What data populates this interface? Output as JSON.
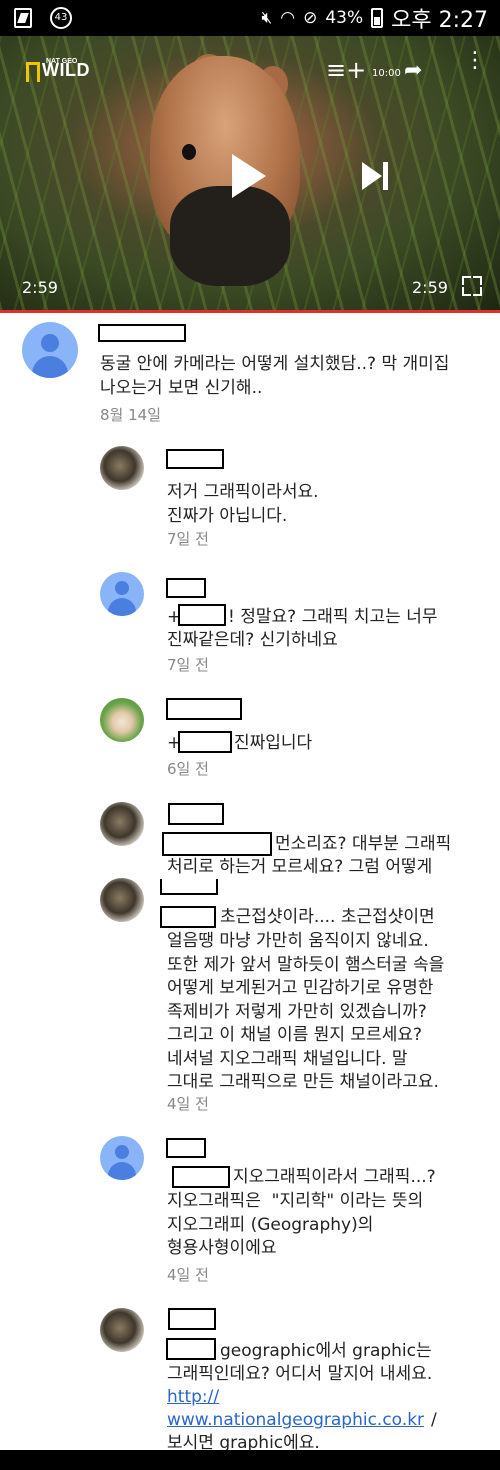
{
  "status_bar": {
    "notification_count": "43",
    "battery_percent": "43%",
    "time": "오후 2:27"
  },
  "video": {
    "channel_logo_small": "NAT GEO",
    "channel_logo_big": "WILD",
    "elapsed": "2:59",
    "duration": "2:59",
    "overlay_text": "10:00"
  },
  "comments": [
    {
      "body": "동굴 안에 카메라는 어떻게 설치했담..? 막 개미집\n나오는거 보면 신기해..",
      "time": "8월 14일"
    },
    {
      "body": "저거 그래픽이라서요.\n진짜가 아닙니다.",
      "time": "7일 전"
    },
    {
      "body_prefix": "+",
      "body_after": "! 정말요? 그래픽 치고는 너무",
      "body_line2": "진짜같은데? 신기하네요",
      "time": "7일 전"
    },
    {
      "body_prefix": "+",
      "body_after": "진짜입니다",
      "time": "6일 전"
    },
    {
      "body_after": "먼소리죠? 대부분 그래픽",
      "body_line2": "처리로 하는거 모르세요? 그럼 어떻게"
    },
    {
      "body_after": "초근접샷이라.... 초근접샷이면",
      "body_rest": "얼음땡 마냥 가만히 움직이지 않네요.\n또한 제가 앞서 말하듯이 햄스터굴 속을\n어떻게 보게된거고 민감하기로 유명한\n족제비가 저렇게 가만히 있겠습니까?\n그리고 이 채널 이름 뭔지 모르세요?\n네셔널 지오그래픽 채널입니다. 말\n그대로 그래픽으로 만든 채널이라고요.",
      "time": "4일 전"
    },
    {
      "body_after": "지오그래픽이라서 그래픽...?",
      "body_rest": "지오그래픽은  \"지리학\" 이라는 뜻의\n지오그래피 (Geography)의\n형용사형이에요",
      "time": "4일 전"
    },
    {
      "body_after": "geographic에서 graphic는",
      "body_line2": "그래픽인데요? 어디서 말지어 내세요.",
      "link_line1": "http://",
      "link_line2": "www.nationalgeographic.co.kr",
      "link_suffix": "/",
      "body_line3": "보시면 graphic에요."
    }
  ]
}
